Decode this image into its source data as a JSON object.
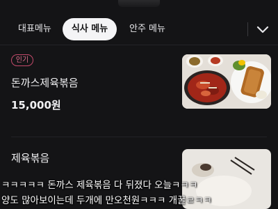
{
  "tabs": [
    {
      "label": "대표메뉴",
      "active": false
    },
    {
      "label": "식사 메뉴",
      "active": true
    },
    {
      "label": "안주 메뉴",
      "active": false
    }
  ],
  "menu": {
    "items": [
      {
        "badge": "인기",
        "name": "돈까스제육볶음",
        "price": "15,000원"
      },
      {
        "name": "제육볶음"
      }
    ]
  },
  "captions": [
    "ㅋㅋㅋㅋㅋ 돈까스 제육볶음 다 뒤졌다 오늘ㅋㅋㅋ",
    "양도 많아보이는데 두개에 만오천원ㅋㅋㅋ 개꿀ㄹㅋㅋ"
  ],
  "icons": {
    "expand": "chevron-down-icon"
  },
  "colors": {
    "background": "#141416",
    "active_tab_bg": "#f4f4f6",
    "badge": "#c44a6b"
  }
}
